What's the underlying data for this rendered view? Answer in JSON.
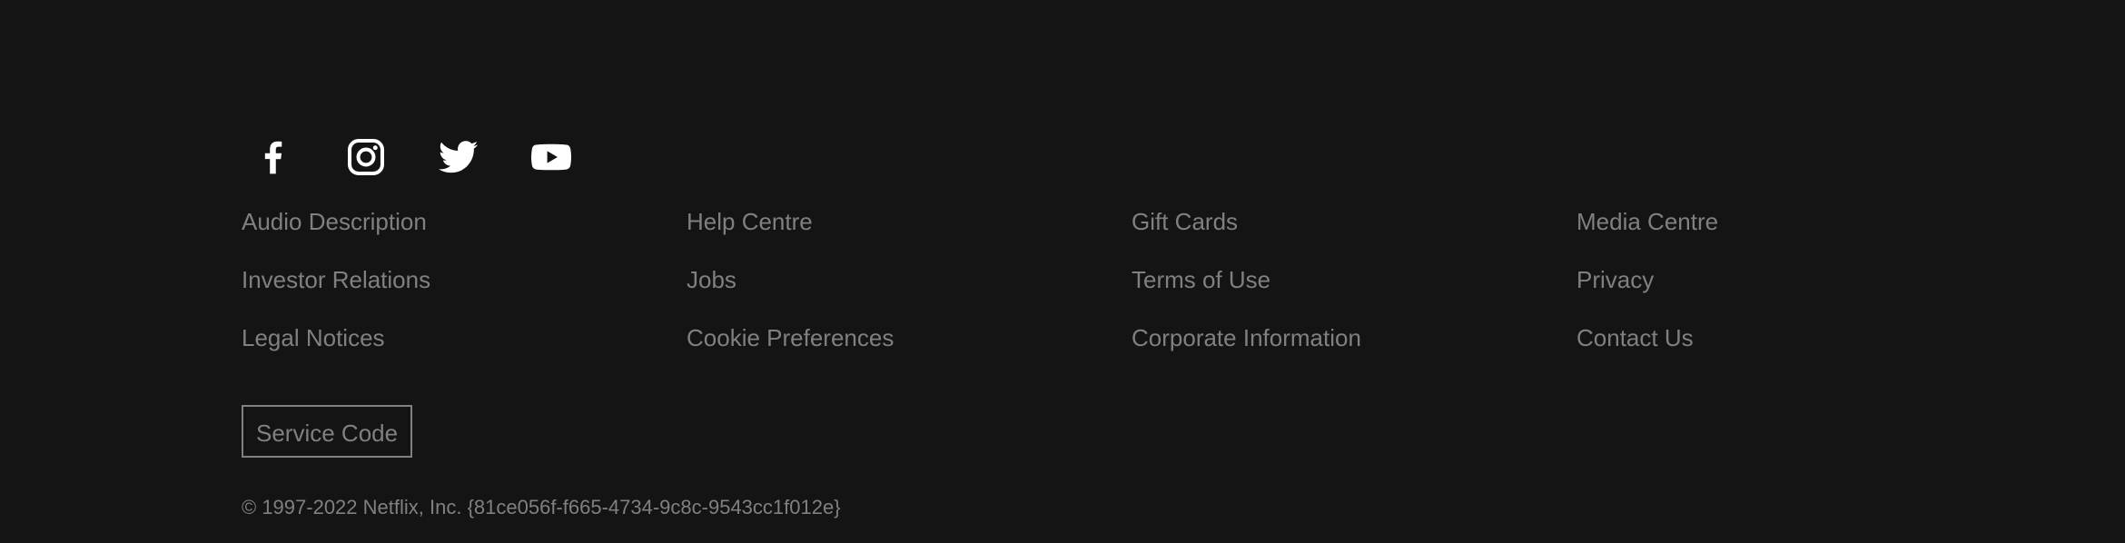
{
  "social": [
    {
      "name": "facebook",
      "icon": "facebook-icon"
    },
    {
      "name": "instagram",
      "icon": "instagram-icon"
    },
    {
      "name": "twitter",
      "icon": "twitter-icon"
    },
    {
      "name": "youtube",
      "icon": "youtube-icon"
    }
  ],
  "links": {
    "audio_description": "Audio Description",
    "help_centre": "Help Centre",
    "gift_cards": "Gift Cards",
    "media_centre": "Media Centre",
    "investor_relations": "Investor Relations",
    "jobs": "Jobs",
    "terms_of_use": "Terms of Use",
    "privacy": "Privacy",
    "legal_notices": "Legal Notices",
    "cookie_preferences": "Cookie Preferences",
    "corporate_information": "Corporate Information",
    "contact_us": "Contact Us"
  },
  "service_code_label": "Service Code",
  "copyright": "© 1997-2022 Netflix, Inc. {81ce056f-f665-4734-9c8c-9543cc1f012e}",
  "colors": {
    "background": "#141414",
    "text": "#808080",
    "icon": "#ffffff"
  }
}
